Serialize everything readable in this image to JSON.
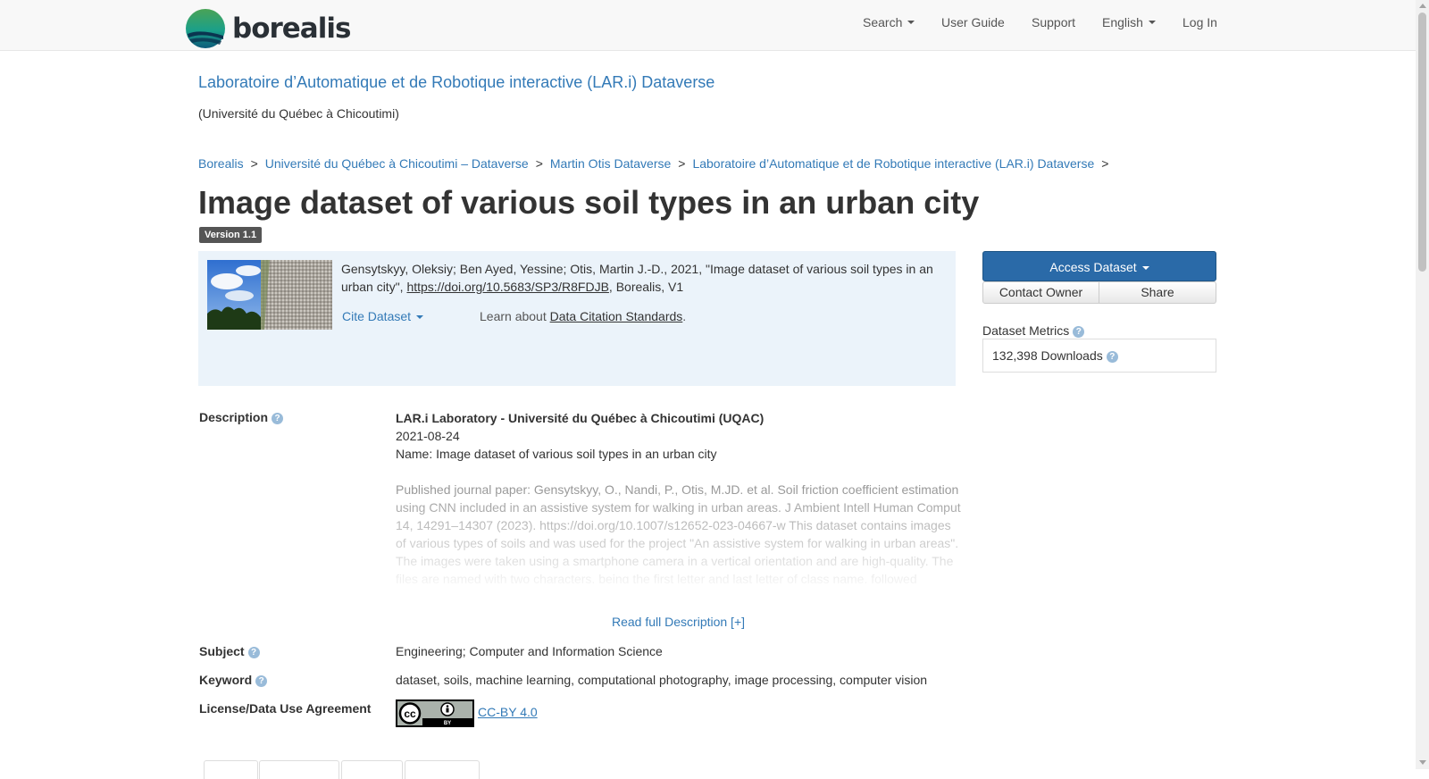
{
  "nav": {
    "brand": "borealis",
    "search": "Search",
    "user_guide": "User Guide",
    "support": "Support",
    "language": "English",
    "login": "Log In"
  },
  "dataverse": {
    "title": "Laboratoire d’Automatique et de Robotique interactive (LAR.i) Dataverse",
    "affiliation": "(Université du Québec à Chicoutimi)"
  },
  "breadcrumb": [
    "Borealis",
    "Université du Québec à Chicoutimi – Dataverse",
    "Martin Otis Dataverse",
    "Laboratoire d’Automatique et de Robotique interactive (LAR.i) Dataverse"
  ],
  "breadcrumb_separator": ">",
  "dataset": {
    "title": "Image dataset of various soil types in an urban city",
    "version": "Version 1.1"
  },
  "citation": {
    "text_before": "Gensytskyy, Oleksiy; Ben Ayed, Yessine; Otis, Martin J.-D., 2021, \"Image dataset of various soil types in an urban city\", ",
    "doi": "https://doi.org/10.5683/SP3/R8FDJB",
    "text_after": ", Borealis, V1",
    "cite_button": "Cite Dataset",
    "learn_prefix": "Learn about ",
    "learn_link": "Data Citation Standards",
    "learn_suffix": "."
  },
  "actions": {
    "access": "Access Dataset",
    "contact": "Contact Owner",
    "share": "Share"
  },
  "metrics": {
    "label": "Dataset Metrics",
    "downloads": "132,398 Downloads"
  },
  "description": {
    "label": "Description",
    "heading": "LAR.i Laboratory - Université du Québec à Chicoutimi (UQAC)",
    "date": "2021-08-24",
    "name": "Name: Image dataset of various soil types in an urban city",
    "body": "Published journal paper: Gensytskyy, O., Nandi, P., Otis, M.JD. et al. Soil friction coefficient estimation using CNN included in an assistive system for walking in urban areas. J Ambient Intell Human Comput 14, 14291–14307 (2023). https://doi.org/10.1007/s12652-023-04667-w This dataset contains images of various types of soils and was used for the project \"An assistive system for walking in urban areas\". The images were taken using a smartphone camera in a vertical orientation and are high-quality. The files are named with two characters, being the first letter and last letter of class name, followed",
    "read_more": "Read full Description [+]"
  },
  "subject": {
    "label": "Subject",
    "value": "Engineering; Computer and Information Science"
  },
  "keyword": {
    "label": "Keyword",
    "value": "dataset, soils, machine learning, computational photography, image processing, computer vision"
  },
  "license": {
    "label": "License/Data Use Agreement",
    "badge_text": "cc BY",
    "link": "CC-BY 4.0"
  },
  "help_glyph": "?",
  "colors": {
    "link": "#337ab7",
    "primary_button": "#2a6aa8",
    "citation_bg": "#ebf3fa",
    "version_badge": "#555555"
  }
}
